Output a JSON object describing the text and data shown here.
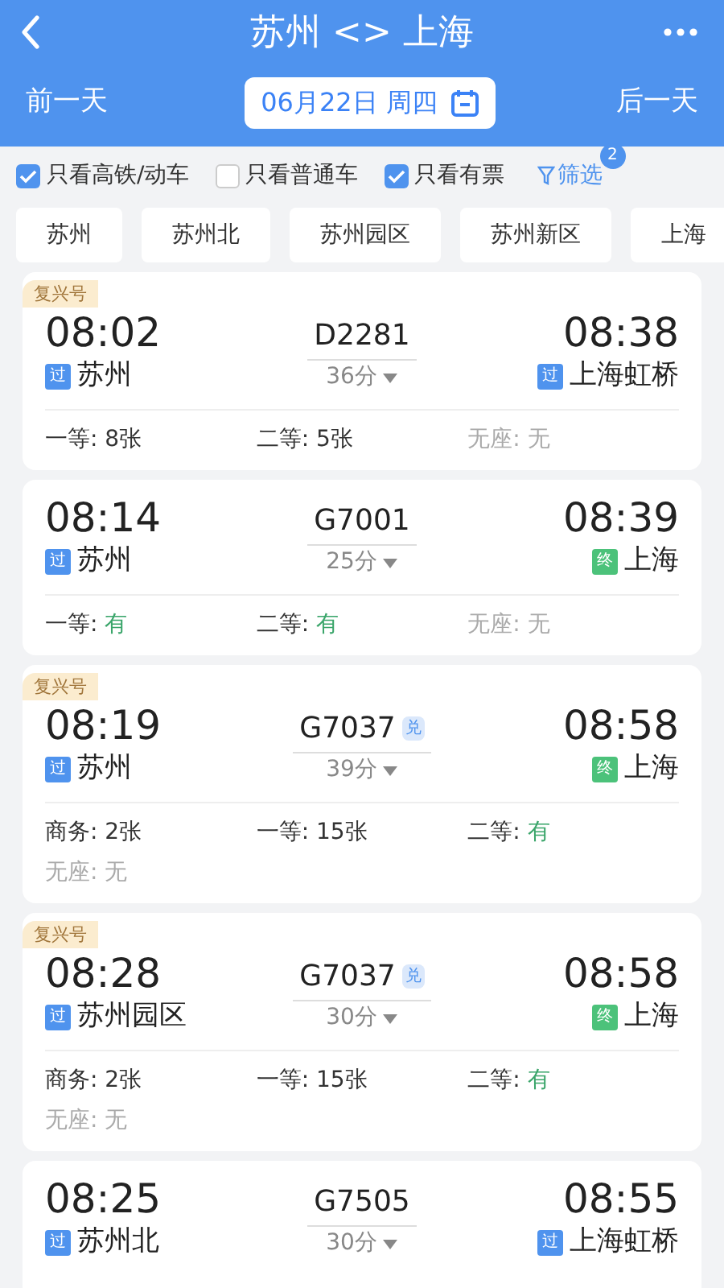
{
  "header": {
    "title": "苏州 <> 上海",
    "prev_day": "前一天",
    "date": "06月22日 周四",
    "next_day": "后一天"
  },
  "filters": [
    {
      "label": "只看高铁/动车",
      "checked": true
    },
    {
      "label": "只看普通车",
      "checked": false
    },
    {
      "label": "只看有票",
      "checked": true
    }
  ],
  "filter_button": {
    "label": "筛选",
    "badge": "2"
  },
  "stations": [
    {
      "label": "苏州"
    },
    {
      "label": "苏州北"
    },
    {
      "label": "苏州园区"
    },
    {
      "label": "苏州新区"
    },
    {
      "label": "上海"
    }
  ],
  "trains": [
    {
      "tag": "复兴号",
      "depart": "08:02",
      "number": "D2281",
      "duration": "36分",
      "arrive": "08:38",
      "from": {
        "badge": "过",
        "kind": "pass",
        "name": "苏州"
      },
      "to": {
        "badge": "过",
        "kind": "pass",
        "name": "上海虹桥"
      },
      "seats": [
        {
          "label": "一等: ",
          "value": "8张",
          "kind": "count"
        },
        {
          "label": "二等: ",
          "value": "5张",
          "kind": "count"
        },
        {
          "label": "无座: ",
          "value": "无",
          "kind": "none"
        }
      ]
    },
    {
      "depart": "08:14",
      "number": "G7001",
      "duration": "25分",
      "arrive": "08:39",
      "from": {
        "badge": "过",
        "kind": "pass",
        "name": "苏州"
      },
      "to": {
        "badge": "终",
        "kind": "end",
        "name": "上海"
      },
      "seats": [
        {
          "label": "一等: ",
          "value": "有",
          "kind": "available"
        },
        {
          "label": "二等: ",
          "value": "有",
          "kind": "available"
        },
        {
          "label": "无座: ",
          "value": "无",
          "kind": "none"
        }
      ]
    },
    {
      "tag": "复兴号",
      "depart": "08:19",
      "number": "G7037",
      "exchange": "兑",
      "duration": "39分",
      "arrive": "08:58",
      "from": {
        "badge": "过",
        "kind": "pass",
        "name": "苏州"
      },
      "to": {
        "badge": "终",
        "kind": "end",
        "name": "上海"
      },
      "seats": [
        {
          "label": "商务: ",
          "value": "2张",
          "kind": "count"
        },
        {
          "label": "一等: ",
          "value": "15张",
          "kind": "count"
        },
        {
          "label": "二等: ",
          "value": "有",
          "kind": "available"
        },
        {
          "label": "无座: ",
          "value": "无",
          "kind": "none"
        }
      ]
    },
    {
      "tag": "复兴号",
      "depart": "08:28",
      "number": "G7037",
      "exchange": "兑",
      "duration": "30分",
      "arrive": "08:58",
      "from": {
        "badge": "过",
        "kind": "pass",
        "name": "苏州园区"
      },
      "to": {
        "badge": "终",
        "kind": "end",
        "name": "上海"
      },
      "seats": [
        {
          "label": "商务: ",
          "value": "2张",
          "kind": "count"
        },
        {
          "label": "一等: ",
          "value": "15张",
          "kind": "count"
        },
        {
          "label": "二等: ",
          "value": "有",
          "kind": "available"
        },
        {
          "label": "无座: ",
          "value": "无",
          "kind": "none"
        }
      ]
    },
    {
      "depart": "08:25",
      "number": "G7505",
      "duration": "30分",
      "arrive": "08:55",
      "from": {
        "badge": "过",
        "kind": "pass",
        "name": "苏州北"
      },
      "to": {
        "badge": "过",
        "kind": "pass",
        "name": "上海虹桥"
      }
    }
  ]
}
